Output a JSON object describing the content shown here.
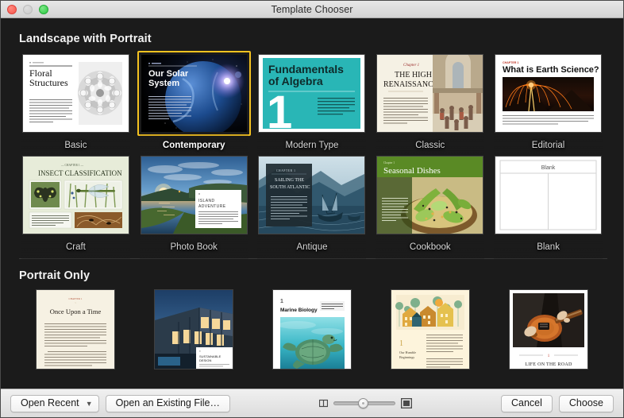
{
  "window": {
    "title": "Template Chooser",
    "traffic_lights": [
      "close",
      "minimize",
      "zoom"
    ]
  },
  "sections": [
    {
      "id": "landscape-with-portrait",
      "title": "Landscape with Portrait",
      "rows": [
        [
          {
            "label": "Basic",
            "selected": false,
            "heading": "Floral Structures",
            "chapter": "Chapter 1"
          },
          {
            "label": "Contemporary",
            "selected": true,
            "heading": "Our Solar System",
            "chapter": "Chapter 1"
          },
          {
            "label": "Modern Type",
            "selected": false,
            "heading": "Fundamentals of Algebra",
            "chapter": "1"
          },
          {
            "label": "Classic",
            "selected": false,
            "heading": "THE HIGH RENAISSANCE",
            "chapter": "Chapter 1"
          },
          {
            "label": "Editorial",
            "selected": false,
            "heading": "What is Earth Science?",
            "chapter": "CHAPTER 1"
          }
        ],
        [
          {
            "label": "Craft",
            "selected": false,
            "heading": "INSECT CLASSIFICATION",
            "chapter": "CHAPTER 1"
          },
          {
            "label": "Photo Book",
            "selected": false,
            "heading": "ISLAND ADVENTURE",
            "chapter": "1"
          },
          {
            "label": "Antique",
            "selected": false,
            "heading": "SAILING THE SOUTH ATLANTIC",
            "chapter": "CHAPTER 1"
          },
          {
            "label": "Cookbook",
            "selected": false,
            "heading": "Seasonal Dishes",
            "chapter": "Chapter 1"
          },
          {
            "label": "Blank",
            "selected": false,
            "heading": "Blank",
            "chapter": ""
          }
        ]
      ]
    },
    {
      "id": "portrait-only",
      "title": "Portrait Only",
      "rows": [
        [
          {
            "label": "",
            "selected": false,
            "heading": "Once Upon a Time",
            "chapter": "CHAPTER 1"
          },
          {
            "label": "",
            "selected": false,
            "heading": "SUSTAINABLE DESIGN",
            "chapter": "1"
          },
          {
            "label": "",
            "selected": false,
            "heading": "Marine Biology",
            "chapter": "1"
          },
          {
            "label": "",
            "selected": false,
            "heading": "Our Humble Beginnings",
            "chapter": "1"
          },
          {
            "label": "",
            "selected": false,
            "heading": "LIFE ON THE ROAD",
            "chapter": ""
          }
        ]
      ]
    }
  ],
  "toolbar": {
    "open_recent_label": "Open Recent",
    "open_recent_chevron": "chevron-down-icon",
    "open_existing_label": "Open an Existing File…",
    "zoom_small_icon": "small-thumbnail-icon",
    "zoom_large_icon": "large-thumbnail-icon",
    "zoom_value": 48,
    "cancel_label": "Cancel",
    "choose_label": "Choose"
  },
  "colors": {
    "selection": "#f5c220",
    "background": "#1b1b1b",
    "modern_type_teal": "#29b6b6",
    "cookbook_green": "#5a8a25",
    "antique_blue": "#2f566e"
  }
}
